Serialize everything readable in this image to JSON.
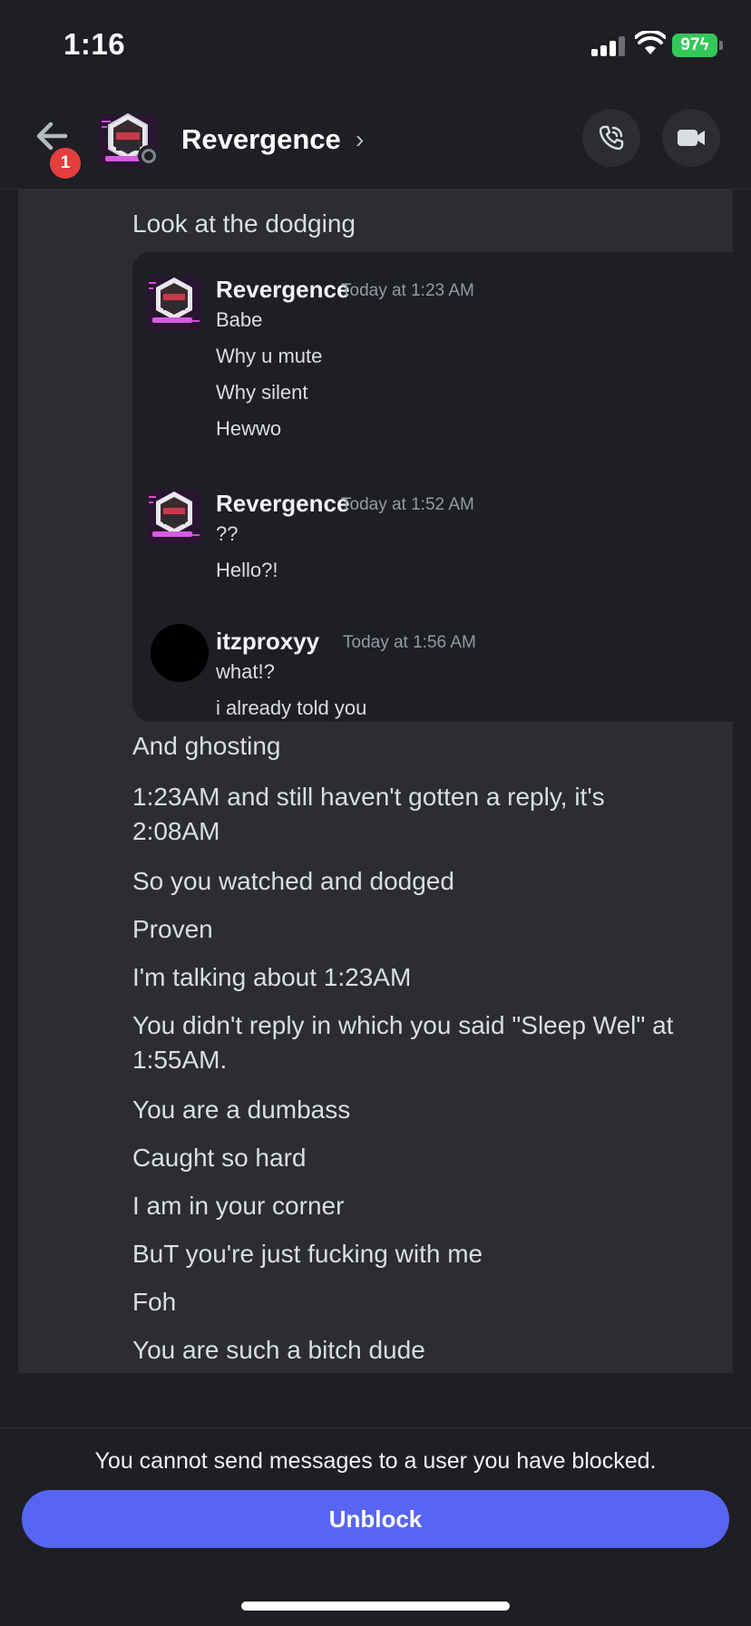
{
  "status_bar": {
    "time": "1:16",
    "battery": "97"
  },
  "header": {
    "back_badge": "1",
    "contact_name": "Revergence",
    "chevron": "›",
    "icons": {
      "back": "arrow-left-icon",
      "call": "phone-icon",
      "video": "video-camera-icon"
    }
  },
  "messages_before": [
    "Look at the dodging"
  ],
  "embed": {
    "groups": [
      {
        "author": "Revergence",
        "timestamp": "Today at 1:23 AM",
        "lines": [
          "Babe",
          "Why u mute",
          "Why silent",
          "Hewwo"
        ]
      },
      {
        "author": "Revergence",
        "timestamp": "Today at 1:52 AM",
        "lines": [
          "??",
          "Hello?!"
        ]
      },
      {
        "author": "itzproxyy",
        "timestamp": "Today at 1:56 AM",
        "lines": [
          "what!?",
          "i already told you"
        ]
      }
    ]
  },
  "messages_after": [
    "And ghosting",
    "1:23AM and still haven't gotten a reply, it's",
    "2:08AM",
    "So you watched and dodged",
    "Proven",
    "I'm talking about 1:23AM",
    "You didn't reply in which you said \"Sleep Wel\" at",
    "1:55AM.",
    "You are a dumbass",
    "Caught so hard",
    "I am in your corner",
    "BuT you're just fucking with me",
    "Foh",
    "You are such a bitch dude"
  ],
  "bottom": {
    "blocked_notice": "You cannot send messages to a user you have blocked.",
    "unblock_label": "Unblock"
  },
  "colors": {
    "accent": "#5865f2",
    "badge": "#e53e3e",
    "battery": "#34c759",
    "background": "#1e1f25",
    "panel": "#2b2d31"
  }
}
